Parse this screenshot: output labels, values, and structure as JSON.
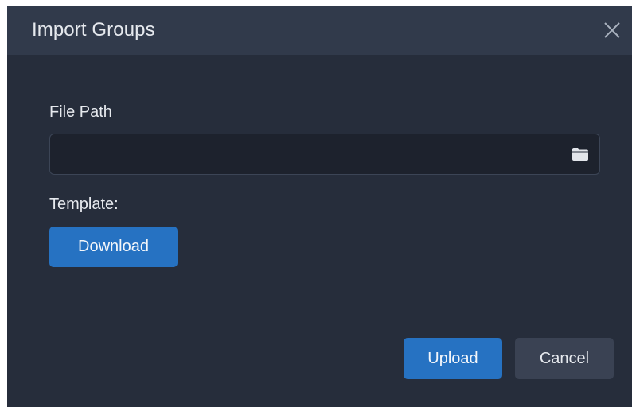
{
  "dialog": {
    "title": "Import Groups",
    "close_icon": "close-icon"
  },
  "form": {
    "file_path_label": "File Path",
    "file_path_value": "",
    "file_path_placeholder": "",
    "browse_icon": "folder-icon",
    "template_label": "Template:",
    "download_label": "Download"
  },
  "footer": {
    "upload_label": "Upload",
    "cancel_label": "Cancel"
  },
  "colors": {
    "dialog_bg": "#262d3b",
    "titlebar_bg": "#313a4b",
    "input_bg": "#1d222d",
    "primary": "#2672c2",
    "secondary": "#3a4253",
    "text": "#e6e9ee"
  }
}
